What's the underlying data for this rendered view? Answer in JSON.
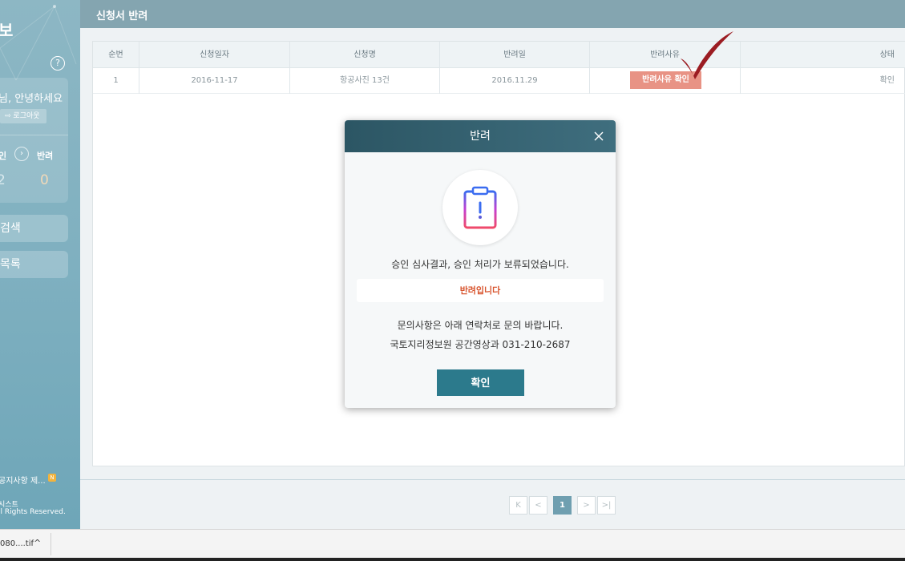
{
  "sidebar": {
    "logo": "보",
    "help": "?",
    "greeting": "님, 안녕하세요",
    "logout": "로그아웃",
    "stat_label_1": "인",
    "stat_label_2": "반려",
    "stat_value_1": "2",
    "stat_value_2": "0",
    "menu_1": "검색",
    "menu_2": "목록",
    "notice": "공지사항 제...",
    "notice_badge": "N",
    "footer_1": "시스트",
    "footer_2": "ll Rights Reserved."
  },
  "header": {
    "title": "신청서 반려"
  },
  "table": {
    "headers": [
      "순번",
      "신청일자",
      "신청명",
      "반려일",
      "반려사유",
      "상태"
    ],
    "rows": [
      {
        "no": "1",
        "apply_date": "2016-11-17",
        "name": "항공사진 13건",
        "reject_date": "2016.11.29",
        "reason_button": "반려사유 확인",
        "status": "확인"
      }
    ]
  },
  "pagination": {
    "first": "K",
    "prev": "<",
    "current": "1",
    "next": ">",
    "last": ">|"
  },
  "modal": {
    "title": "반려",
    "message": "승인 심사결과, 승인 처리가 보류되었습니다.",
    "reason": "반려입니다",
    "info_1": "문의사항은 아래 연락처로 문의 바랍니다.",
    "info_2": "국토지리정보원 공간영상과 031-210-2687",
    "confirm": "확인"
  },
  "download_bar": {
    "file": "080....tif",
    "chevron": "^"
  },
  "colors": {
    "header": "#84a5b0",
    "modal_header": "#2c5664",
    "confirm": "#2c7a8c",
    "reason_button": "#e89385",
    "reason_text": "#d8552f",
    "checkmark": "#9b1c22"
  }
}
